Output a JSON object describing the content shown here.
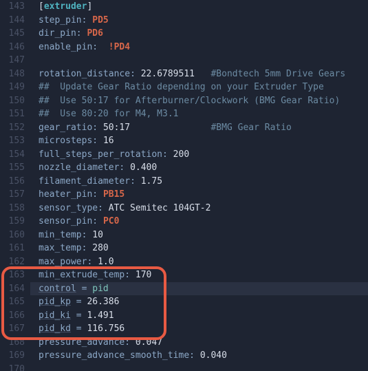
{
  "lines": [
    {
      "n": 143,
      "tokens": [
        {
          "c": "",
          "t": "["
        },
        {
          "c": "ext",
          "t": "extruder"
        },
        {
          "c": "",
          "t": "]"
        }
      ]
    },
    {
      "n": 144,
      "tokens": [
        {
          "c": "k",
          "t": "step_pin"
        },
        {
          "c": "col",
          "t": ": "
        },
        {
          "c": "pin",
          "t": "PD5"
        }
      ]
    },
    {
      "n": 145,
      "tokens": [
        {
          "c": "k",
          "t": "dir_pin"
        },
        {
          "c": "col",
          "t": ": "
        },
        {
          "c": "pin",
          "t": "PD6"
        }
      ]
    },
    {
      "n": 146,
      "tokens": [
        {
          "c": "k",
          "t": "enable_pin"
        },
        {
          "c": "col",
          "t": ": "
        },
        {
          "c": "num",
          "t": " "
        },
        {
          "c": "pin",
          "t": "!PD4"
        }
      ]
    },
    {
      "n": 147,
      "tokens": [
        {
          "c": "",
          "t": ""
        }
      ]
    },
    {
      "n": 148,
      "tokens": [
        {
          "c": "k",
          "t": "rotation_distance"
        },
        {
          "c": "col",
          "t": ": "
        },
        {
          "c": "num",
          "t": "22.6789511"
        },
        {
          "c": "",
          "t": "   "
        },
        {
          "c": "cmt",
          "t": "#Bondtech 5mm Drive Gears"
        }
      ]
    },
    {
      "n": 149,
      "tokens": [
        {
          "c": "cmt",
          "t": "##  Update Gear Ratio depending on your Extruder Type"
        }
      ]
    },
    {
      "n": 150,
      "tokens": [
        {
          "c": "cmt",
          "t": "##  Use 50:17 for Afterburner/Clockwork (BMG Gear Ratio)"
        }
      ]
    },
    {
      "n": 151,
      "tokens": [
        {
          "c": "cmt",
          "t": "##  Use 80:20 for M4, M3.1"
        }
      ]
    },
    {
      "n": 152,
      "tokens": [
        {
          "c": "k",
          "t": "gear_ratio"
        },
        {
          "c": "col",
          "t": ": "
        },
        {
          "c": "num",
          "t": "50:17"
        },
        {
          "c": "",
          "t": "               "
        },
        {
          "c": "cmt",
          "t": "#BMG Gear Ratio"
        }
      ]
    },
    {
      "n": 153,
      "tokens": [
        {
          "c": "k",
          "t": "microsteps"
        },
        {
          "c": "col",
          "t": ": "
        },
        {
          "c": "num",
          "t": "16"
        }
      ]
    },
    {
      "n": 154,
      "tokens": [
        {
          "c": "k",
          "t": "full_steps_per_rotation"
        },
        {
          "c": "col",
          "t": ": "
        },
        {
          "c": "num",
          "t": "200"
        }
      ]
    },
    {
      "n": 155,
      "tokens": [
        {
          "c": "k",
          "t": "nozzle_diameter"
        },
        {
          "c": "col",
          "t": ": "
        },
        {
          "c": "num",
          "t": "0.400"
        }
      ]
    },
    {
      "n": 156,
      "tokens": [
        {
          "c": "k",
          "t": "filament_diameter"
        },
        {
          "c": "col",
          "t": ": "
        },
        {
          "c": "num",
          "t": "1.75"
        }
      ]
    },
    {
      "n": 157,
      "tokens": [
        {
          "c": "k",
          "t": "heater_pin"
        },
        {
          "c": "col",
          "t": ": "
        },
        {
          "c": "pin",
          "t": "PB15"
        }
      ]
    },
    {
      "n": 158,
      "tokens": [
        {
          "c": "k",
          "t": "sensor_type"
        },
        {
          "c": "col",
          "t": ": "
        },
        {
          "c": "num",
          "t": "ATC Semitec 104GT-2"
        }
      ]
    },
    {
      "n": 159,
      "tokens": [
        {
          "c": "k",
          "t": "sensor_pin"
        },
        {
          "c": "col",
          "t": ": "
        },
        {
          "c": "pin",
          "t": "PC0"
        }
      ]
    },
    {
      "n": 160,
      "tokens": [
        {
          "c": "k",
          "t": "min_temp"
        },
        {
          "c": "col",
          "t": ": "
        },
        {
          "c": "num",
          "t": "10"
        }
      ]
    },
    {
      "n": 161,
      "tokens": [
        {
          "c": "k",
          "t": "max_temp"
        },
        {
          "c": "col",
          "t": ": "
        },
        {
          "c": "num",
          "t": "280"
        }
      ]
    },
    {
      "n": 162,
      "tokens": [
        {
          "c": "k",
          "t": "max_power"
        },
        {
          "c": "col",
          "t": ": "
        },
        {
          "c": "num",
          "t": "1.0"
        }
      ]
    },
    {
      "n": 163,
      "tokens": [
        {
          "c": "k",
          "t": "min_extrude_temp"
        },
        {
          "c": "col",
          "t": ": "
        },
        {
          "c": "num",
          "t": "170"
        }
      ]
    },
    {
      "n": 164,
      "highlight": true,
      "tokens": [
        {
          "c": "k kund",
          "t": "control"
        },
        {
          "c": "eq",
          "t": " = "
        },
        {
          "c": "pidkw",
          "t": "pid"
        }
      ]
    },
    {
      "n": 165,
      "tokens": [
        {
          "c": "k kund",
          "t": "pid_kp"
        },
        {
          "c": "eq",
          "t": " = "
        },
        {
          "c": "num",
          "t": "26.386"
        }
      ]
    },
    {
      "n": 166,
      "tokens": [
        {
          "c": "k kund",
          "t": "pid_ki"
        },
        {
          "c": "eq",
          "t": " = "
        },
        {
          "c": "num",
          "t": "1.491"
        }
      ]
    },
    {
      "n": 167,
      "tokens": [
        {
          "c": "k kund",
          "t": "pid_kd"
        },
        {
          "c": "eq",
          "t": " = "
        },
        {
          "c": "num",
          "t": "116.756"
        }
      ]
    },
    {
      "n": 168,
      "tokens": [
        {
          "c": "k",
          "t": "pressure_advance"
        },
        {
          "c": "col",
          "t": ": "
        },
        {
          "c": "num",
          "t": "0.047"
        }
      ]
    },
    {
      "n": 169,
      "tokens": [
        {
          "c": "k",
          "t": "pressure_advance_smooth_time"
        },
        {
          "c": "col",
          "t": ": "
        },
        {
          "c": "num",
          "t": "0.040"
        }
      ]
    },
    {
      "n": 170,
      "tokens": [
        {
          "c": "",
          "t": ""
        }
      ]
    }
  ]
}
